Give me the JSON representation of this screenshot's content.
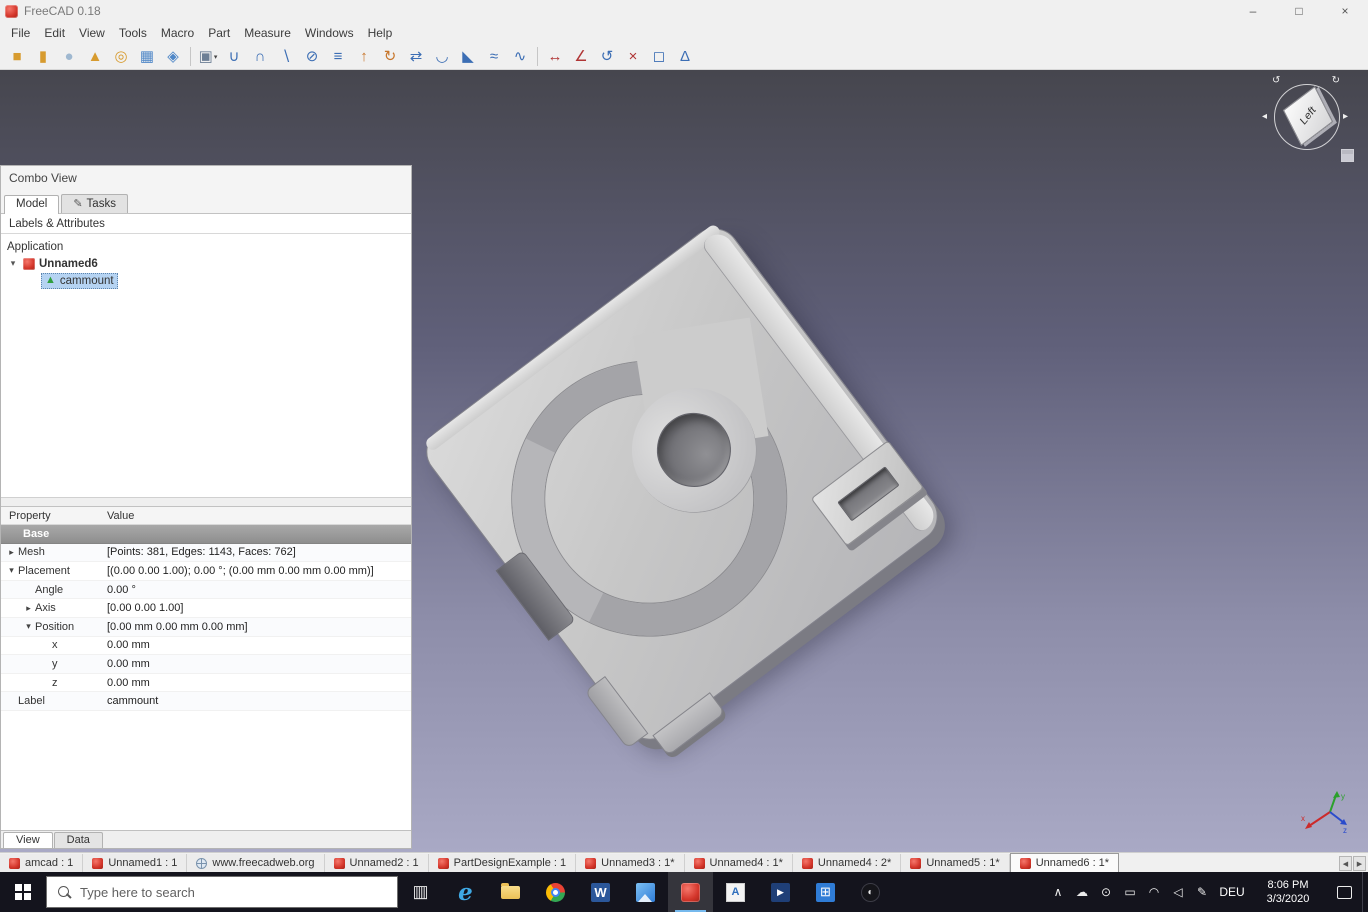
{
  "window": {
    "title": "FreeCAD 0.18",
    "controls": [
      {
        "name": "minimize-button",
        "glyph": "–"
      },
      {
        "name": "maximize-button",
        "glyph": "□"
      },
      {
        "name": "close-button",
        "glyph": "×"
      }
    ]
  },
  "menubar": {
    "items": [
      "File",
      "Edit",
      "View",
      "Tools",
      "Macro",
      "Part",
      "Measure",
      "Windows",
      "Help"
    ]
  },
  "toolbar": {
    "groups": [
      [
        {
          "name": "part-box-icon",
          "glyph": "■",
          "color": "#d79b2f"
        },
        {
          "name": "part-cylinder-icon",
          "glyph": "▮",
          "color": "#d79b2f"
        },
        {
          "name": "part-sphere-icon",
          "glyph": "●",
          "color": "#9fb8d0"
        },
        {
          "name": "part-cone-icon",
          "glyph": "▲",
          "color": "#d79b2f"
        },
        {
          "name": "part-torus-icon",
          "glyph": "◎",
          "color": "#d79b2f"
        },
        {
          "name": "part-primitives-icon",
          "glyph": "▦",
          "color": "#4f87c7"
        },
        {
          "name": "part-shapebuilder-icon",
          "glyph": "◈",
          "color": "#4f87c7"
        }
      ],
      [
        {
          "name": "part-compound-icon",
          "glyph": "▣",
          "color": "#6d7f95",
          "dropdown": true
        },
        {
          "name": "part-boolean-union-icon",
          "glyph": "∪",
          "color": "#3c6eb4"
        },
        {
          "name": "part-boolean-common-icon",
          "glyph": "∩",
          "color": "#3c6eb4"
        },
        {
          "name": "part-boolean-cut-icon",
          "glyph": "∖",
          "color": "#3c6eb4"
        },
        {
          "name": "part-section-icon",
          "glyph": "⊘",
          "color": "#3c6eb4"
        },
        {
          "name": "part-cross-sections-icon",
          "glyph": "≡",
          "color": "#3c6eb4"
        },
        {
          "name": "part-extrude-icon",
          "glyph": "↑",
          "color": "#c7762b"
        },
        {
          "name": "part-revolve-icon",
          "glyph": "↻",
          "color": "#c7762b"
        },
        {
          "name": "part-mirror-icon",
          "glyph": "⇄",
          "color": "#3c6eb4"
        },
        {
          "name": "part-fillet-icon",
          "glyph": "◡",
          "color": "#3c6eb4"
        },
        {
          "name": "part-chamfer-icon",
          "glyph": "◣",
          "color": "#3c6eb4"
        },
        {
          "name": "part-loft-icon",
          "glyph": "≈",
          "color": "#3c6eb4"
        },
        {
          "name": "part-sweep-icon",
          "glyph": "∿",
          "color": "#3c6eb4"
        }
      ],
      [
        {
          "name": "measure-linear-icon",
          "glyph": "↔",
          "color": "#b03535"
        },
        {
          "name": "measure-angular-icon",
          "glyph": "∠",
          "color": "#b03535"
        },
        {
          "name": "measure-refresh-icon",
          "glyph": "↺",
          "color": "#3c6eb4"
        },
        {
          "name": "measure-clear-icon",
          "glyph": "×",
          "color": "#b03535"
        },
        {
          "name": "measure-toggle-3d-icon",
          "glyph": "◻",
          "color": "#3c6eb4"
        },
        {
          "name": "measure-toggle-delta-icon",
          "glyph": "Δ",
          "color": "#3c6eb4"
        }
      ]
    ]
  },
  "viewport": {
    "nav_cube_face": "Left",
    "part_label": "cammount"
  },
  "combo_view": {
    "title": "Combo View",
    "tabs": [
      {
        "label": "Model",
        "active": true
      },
      {
        "label": "Tasks",
        "active": false,
        "icon": "pencil"
      }
    ],
    "header": "Labels & Attributes",
    "tree": {
      "application": "Application",
      "document": "Unnamed6",
      "item": "cammount"
    },
    "bottom_tabs": [
      {
        "label": "View",
        "active": true
      },
      {
        "label": "Data",
        "active": false
      }
    ]
  },
  "property_panel": {
    "columns": [
      "Property",
      "Value"
    ],
    "rows": [
      {
        "property": "Base",
        "value": "",
        "indent": 0,
        "group": true
      },
      {
        "property": "Mesh",
        "value": "[Points: 381, Edges: 1143, Faces: 762]",
        "indent": 0,
        "arrow": "collapsed"
      },
      {
        "property": "Placement",
        "value": "[(0.00 0.00 1.00); 0.00 °; (0.00 mm 0.00 mm 0.00 mm)]",
        "indent": 0,
        "arrow": "expanded"
      },
      {
        "property": "Angle",
        "value": "0.00 °",
        "indent": 1
      },
      {
        "property": "Axis",
        "value": "[0.00 0.00 1.00]",
        "indent": 1,
        "arrow": "collapsed"
      },
      {
        "property": "Position",
        "value": "[0.00 mm 0.00 mm 0.00 mm]",
        "indent": 1,
        "arrow": "expanded"
      },
      {
        "property": "x",
        "value": "0.00 mm",
        "indent": 2
      },
      {
        "property": "y",
        "value": "0.00 mm",
        "indent": 2
      },
      {
        "property": "z",
        "value": "0.00 mm",
        "indent": 2
      },
      {
        "property": "Label",
        "value": "cammount",
        "indent": 0
      }
    ]
  },
  "mdi_bar": {
    "tabs": [
      {
        "label": "amcad : 1",
        "icon": "freecad"
      },
      {
        "label": "Unnamed1 : 1",
        "icon": "freecad"
      },
      {
        "label": "www.freecadweb.org",
        "icon": "web"
      },
      {
        "label": "Unnamed2 : 1",
        "icon": "freecad"
      },
      {
        "label": "PartDesignExample : 1",
        "icon": "freecad"
      },
      {
        "label": "Unnamed3 : 1*",
        "icon": "freecad"
      },
      {
        "label": "Unnamed4 : 1*",
        "icon": "freecad"
      },
      {
        "label": "Unnamed4 : 2*",
        "icon": "freecad"
      },
      {
        "label": "Unnamed5 : 1*",
        "icon": "freecad"
      },
      {
        "label": "Unnamed6 : 1*",
        "icon": "freecad",
        "active": true
      }
    ],
    "scroll_left": "◀",
    "scroll_right": "▶"
  },
  "taskbar": {
    "search_placeholder": "Type here to search",
    "apps": [
      {
        "name": "task-view-button",
        "style": "taskview",
        "glyph": "▥"
      },
      {
        "name": "edge-app-icon",
        "style": "edge",
        "glyph": "e"
      },
      {
        "name": "file-explorer-app-icon",
        "style": "folder",
        "glyph": ""
      },
      {
        "name": "chrome-app-icon",
        "style": "chrome",
        "glyph": ""
      },
      {
        "name": "word-app-icon",
        "style": "word",
        "glyph": "W"
      },
      {
        "name": "photos-app-icon",
        "style": "photos",
        "glyph": ""
      },
      {
        "name": "freecad-app-icon",
        "style": "freecad",
        "glyph": "",
        "active": true
      },
      {
        "name": "photo-viewer-app-icon",
        "style": "viewer",
        "glyph": "A"
      },
      {
        "name": "movies-app-icon",
        "style": "movies",
        "glyph": "▶"
      },
      {
        "name": "store-app-icon",
        "style": "store",
        "glyph": "⊞"
      },
      {
        "name": "dark-circle-app-icon",
        "style": "darkapp",
        "glyph": "◐"
      }
    ],
    "tray": [
      {
        "name": "tray-expand-icon",
        "glyph": "∧"
      },
      {
        "name": "onedrive-icon",
        "glyph": "☁"
      },
      {
        "name": "meet-now-icon",
        "glyph": "⊙"
      },
      {
        "name": "battery-icon",
        "glyph": "▭"
      },
      {
        "name": "network-icon",
        "glyph": "◠"
      },
      {
        "name": "volume-icon",
        "glyph": "◁"
      },
      {
        "name": "pen-icon",
        "glyph": "✎"
      }
    ],
    "language": "DEU",
    "time": "8:06 PM",
    "date": "3/3/2020"
  }
}
